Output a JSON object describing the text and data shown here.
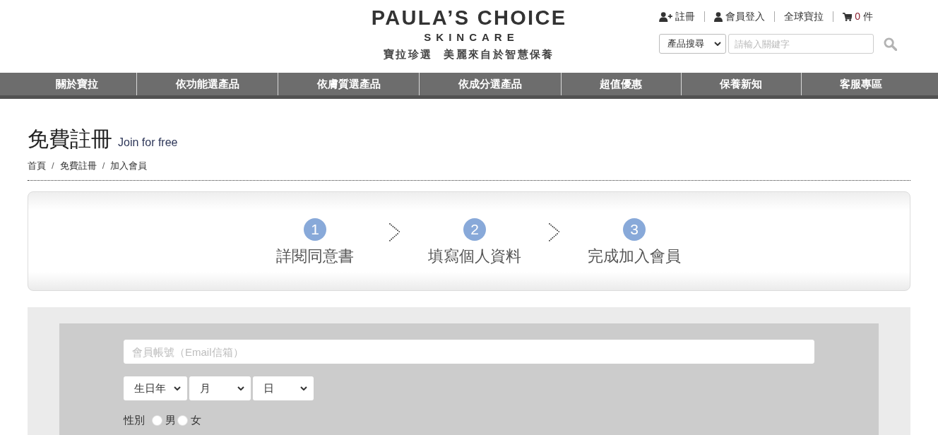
{
  "header": {
    "logo": {
      "brand": "PAULA’S CHOICE",
      "subbrand": "SKINCARE",
      "tagline": "寶拉珍選 美麗來自於智慧保養"
    },
    "top_links": [
      {
        "kind": "register",
        "label": "註冊"
      },
      {
        "kind": "login",
        "label": "會員登入"
      },
      {
        "kind": "plain",
        "label": "全球寶拉"
      },
      {
        "kind": "cart",
        "count": "0",
        "label": "件"
      }
    ],
    "search": {
      "category": "產品搜尋",
      "placeholder": "請輸入關鍵字"
    }
  },
  "nav": [
    "關於寶拉",
    "依功能選產品",
    "依膚質選產品",
    "依成分選產品",
    "超值優惠",
    "保養新知",
    "客服專區"
  ],
  "page": {
    "title": "免費註冊",
    "subtitle": "Join for free",
    "breadcrumb": {
      "separator": "/",
      "items": [
        "首頁",
        "免費註冊",
        "加入會員"
      ]
    }
  },
  "steps": [
    {
      "number": "1",
      "label": "詳閱同意書"
    },
    {
      "number": "2",
      "label": "填寫個人資料"
    },
    {
      "number": "3",
      "label": "完成加入會員"
    }
  ],
  "form": {
    "email": {
      "placeholder": "會員帳號（Email信箱）"
    },
    "birthday": [
      "生日年",
      "月",
      "日"
    ],
    "gender": {
      "label": "性別",
      "options": [
        {
          "label": "男",
          "checked": false
        },
        {
          "label": "女",
          "checked": false
        }
      ]
    }
  }
}
